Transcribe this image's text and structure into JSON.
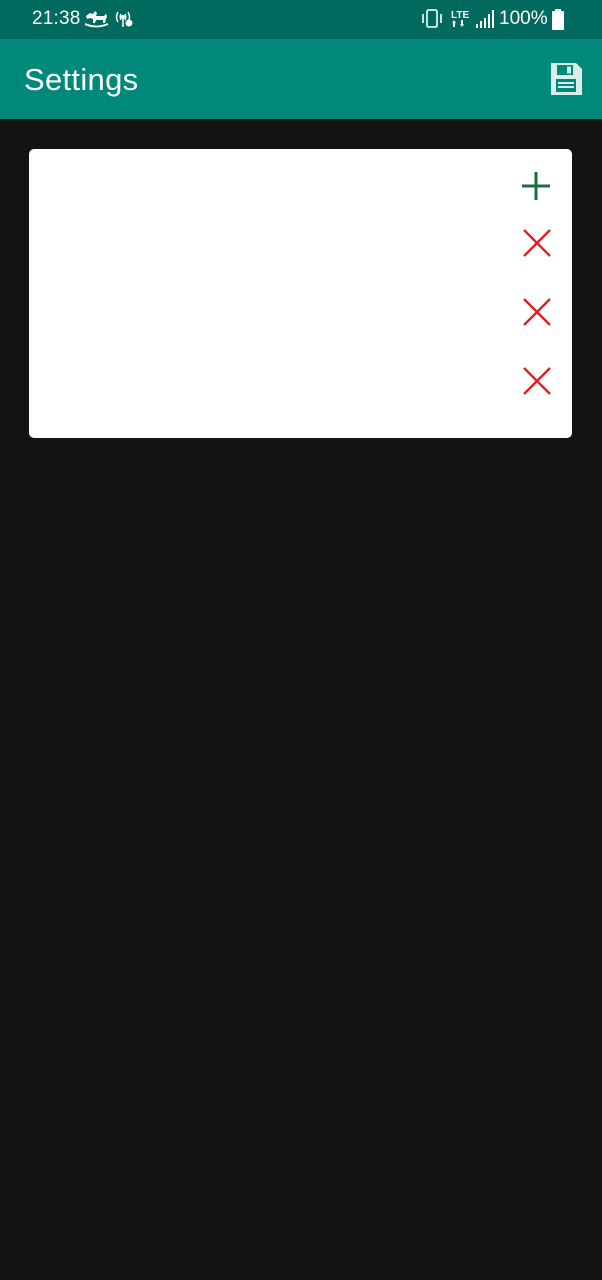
{
  "status_bar": {
    "time": "21:38",
    "battery_percent": "100%",
    "network_type": "LTE",
    "icons": [
      "horse-icon",
      "hotspot-icon",
      "vibrate-icon",
      "lte-icon",
      "signal-icon",
      "battery-icon"
    ]
  },
  "app_bar": {
    "title": "Settings",
    "save_icon": "floppy-disk-icon"
  },
  "card": {
    "add_icon": "plus-icon",
    "remove_icon": "close-icon",
    "rows": 3
  },
  "colors": {
    "status_bar": "#006a5e",
    "app_bar": "#00897b",
    "background": "#131313",
    "card": "#ffffff",
    "add_green": "#1b6e3c",
    "remove_red": "#e02020"
  }
}
